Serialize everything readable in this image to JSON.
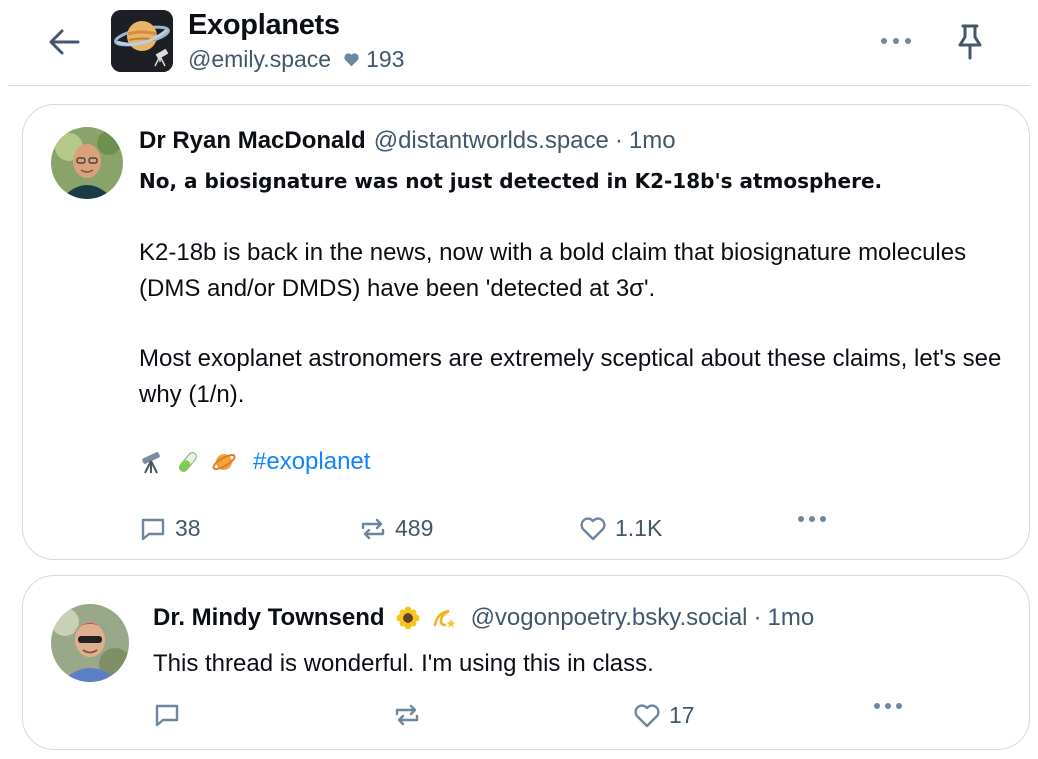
{
  "header": {
    "feed_title": "Exoplanets",
    "feed_handle": "@emily.space",
    "like_count": "193"
  },
  "posts": [
    {
      "author": "Dr Ryan MacDonald",
      "handle": "@distantworlds.space",
      "age": "1mo",
      "headline": "No, a biosignature was not just detected in K2-18b's atmosphere.",
      "paragraphs": [
        "K2-18b is back in the news, now with a bold claim that biosignature molecules (DMS and/or DMDS) have been 'detected at 3σ'.",
        "Most exoplanet astronomers are extremely sceptical about these claims, let's see why (1/n)."
      ],
      "emojis": [
        "telescope-emoji",
        "test-tube-emoji",
        "ringed-planet-emoji"
      ],
      "hashtag": "#exoplanet",
      "reply_count": "38",
      "repost_count": "489",
      "like_count": "1.1K"
    },
    {
      "author": "Dr. Mindy Townsend",
      "emojis": [
        "sunflower-emoji",
        "dizzy-emoji"
      ],
      "handle": "@vogonpoetry.bsky.social",
      "age": "1mo",
      "text": "This thread is wonderful. I'm using this in class.",
      "reply_count": "",
      "repost_count": "",
      "like_count": "17"
    }
  ],
  "colors": {
    "text": "#0b0f14",
    "muted": "#42576c",
    "link": "#1083fe",
    "border": "#d4dbe2"
  }
}
